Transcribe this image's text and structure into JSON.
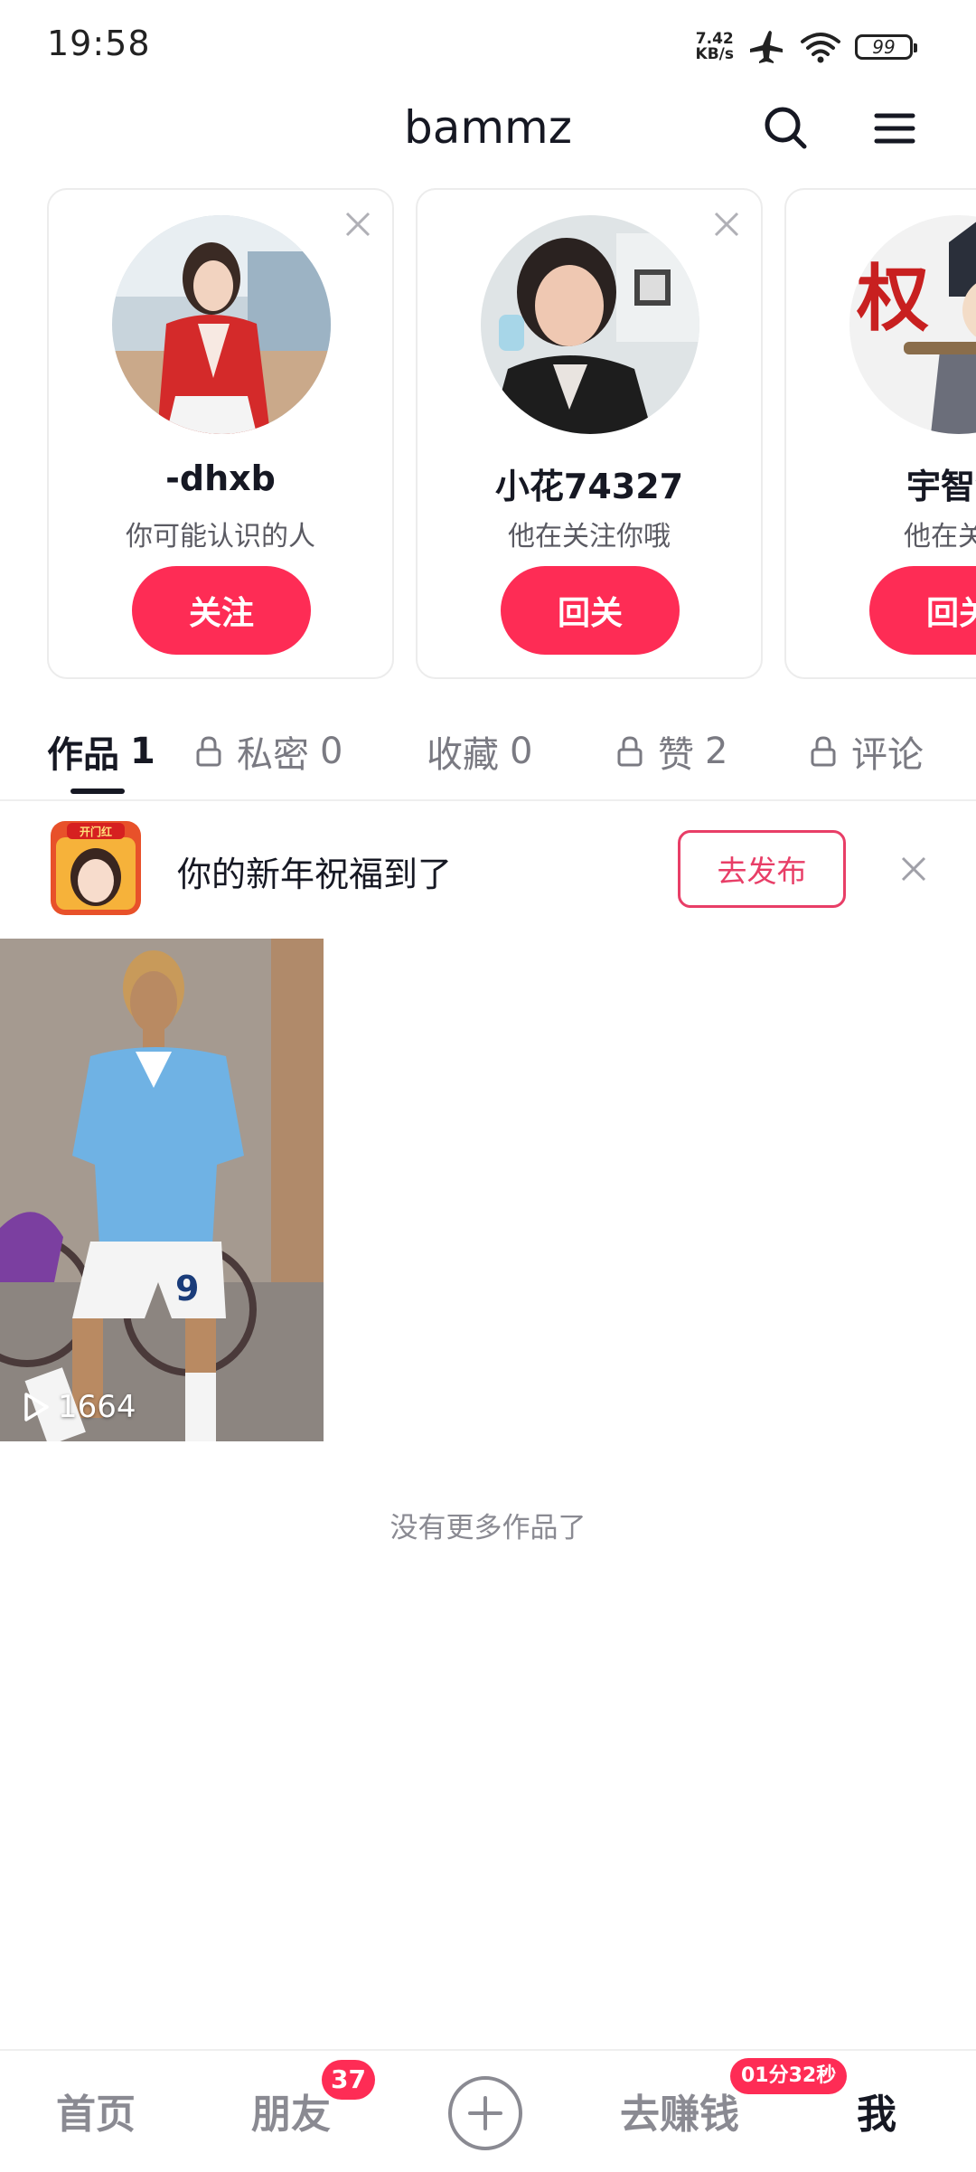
{
  "status_bar": {
    "time": "19:58",
    "net_speed_value": "7.42",
    "net_speed_unit": "KB/s",
    "battery": "99",
    "icons": [
      "airplane-icon",
      "wifi-icon",
      "battery-icon"
    ]
  },
  "header": {
    "title": "bammz",
    "icons": [
      "search-icon",
      "menu-icon"
    ]
  },
  "recommendations": [
    {
      "name": "-dhxb",
      "subtitle": "你可能认识的人",
      "button": "关注"
    },
    {
      "name": "小花74327",
      "subtitle": "他在关注你哦",
      "button": "回关"
    },
    {
      "name": "宇智波",
      "subtitle": "他在关注",
      "button": "回关"
    }
  ],
  "tabs": [
    {
      "label": "作品",
      "count": "1",
      "locked": false,
      "active": true
    },
    {
      "label": "私密",
      "count": "0",
      "locked": true,
      "active": false
    },
    {
      "label": "收藏",
      "count": "0",
      "locked": false,
      "active": false
    },
    {
      "label": "赞",
      "count": "2",
      "locked": true,
      "active": false
    },
    {
      "label": "评论",
      "count": "",
      "locked": true,
      "active": false
    }
  ],
  "banner": {
    "thumb_label": "开门红",
    "text": "你的新年祝福到了",
    "button": "去发布"
  },
  "videos": [
    {
      "plays": "1664"
    }
  ],
  "no_more_text": "没有更多作品了",
  "bottom_nav": {
    "home": "首页",
    "friends": "朋友",
    "friends_badge": "37",
    "earn": "去赚钱",
    "earn_badge": "01分32秒",
    "me": "我"
  },
  "colors": {
    "accent": "#fe2c55",
    "banner_accent": "#e83e67",
    "text_primary": "#161823",
    "text_secondary": "#7a7a82"
  }
}
